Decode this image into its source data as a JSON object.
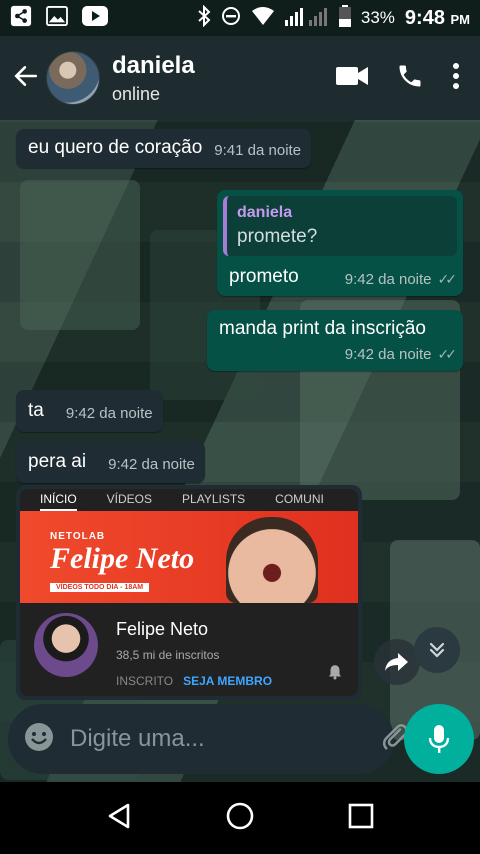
{
  "status_bar": {
    "battery": "33%",
    "time": "9:48",
    "ampm": "PM"
  },
  "header": {
    "contact_name": "daniela",
    "status": "online"
  },
  "messages": [
    {
      "text": "eu quero de coração",
      "time": "9:41 da noite"
    },
    {
      "quote_author": "daniela",
      "quote_text": "promete?",
      "text": "prometo",
      "time": "9:42 da noite"
    },
    {
      "text": "manda print da inscrição",
      "time": "9:42 da noite"
    },
    {
      "text": "ta",
      "time": "9:42 da noite"
    },
    {
      "text": "pera ai",
      "time": "9:42 da noite"
    }
  ],
  "image_preview": {
    "tabs": [
      "INÍCIO",
      "VÍDEOS",
      "PLAYLISTS",
      "COMUNI"
    ],
    "banner_label": "NETOLAB",
    "banner_logo": "Felipe Neto",
    "banner_sub": "VÍDEOS TODO DIA - 18AM",
    "channel_name": "Felipe Neto",
    "subscribers": "38,5 mi de inscritos",
    "subscribed": "INSCRITO",
    "member": "SEJA MEMBRO"
  },
  "composer": {
    "placeholder": "Digite uma..."
  },
  "colors": {
    "outgoing": "#055145",
    "incoming": "#1f2c33",
    "accent": "#00af9c"
  }
}
